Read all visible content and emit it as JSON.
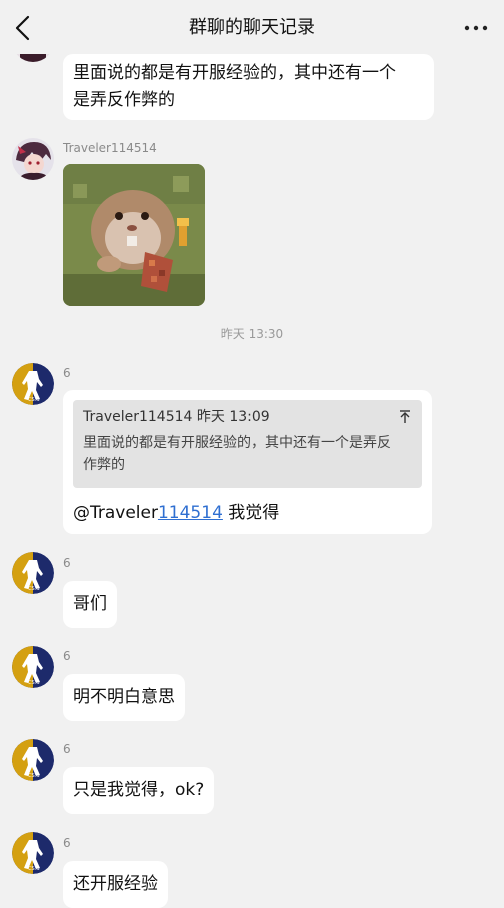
{
  "header": {
    "title": "群聊的聊天记录"
  },
  "icons": {
    "back": "chevron-left-icon",
    "more": "more-dots-icon",
    "quote": "scroll-to-top-icon"
  },
  "messages": [
    {
      "text_line1": "里面说的都是有开服经验的，其中还有一个",
      "text_line2": "是弄反作弊的"
    },
    {
      "nickname": "Traveler114514",
      "image": "hamster-minecraft-sticker"
    }
  ],
  "timestamp": "昨天 13:30",
  "reply_message": {
    "nickname": "6",
    "quote_author": "Traveler114514",
    "quote_time": "昨天 13:09",
    "quote_line1": "里面说的都是有开服经验的，其中还有一个是弄反",
    "quote_line2": "作弊的",
    "mention_prefix": "@Traveler",
    "mention_link": "114514",
    "mention_suffix": " 我觉得"
  },
  "simple_messages": [
    {
      "nickname": "6",
      "text": "哥们"
    },
    {
      "nickname": "6",
      "text": "明不明白意思"
    },
    {
      "nickname": "6",
      "text": "只是我觉得，ok?"
    },
    {
      "nickname": "6",
      "text": "还开服经验"
    }
  ],
  "colors": {
    "background": "#f1f1f1",
    "bubble": "#ffffff",
    "link": "#2f6fd1",
    "avatar_navy": "#1d2a6b",
    "avatar_gold": "#d4a011"
  }
}
